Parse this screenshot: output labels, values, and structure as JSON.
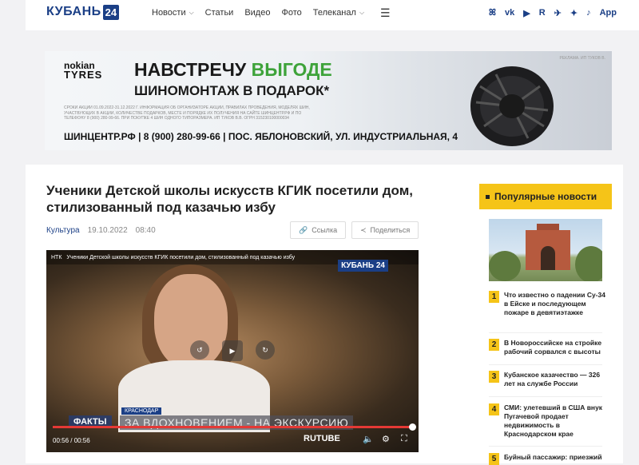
{
  "header": {
    "logo_text": "КУБАНЬ",
    "logo_num": "24",
    "nav": [
      {
        "label": "Новости",
        "has_dropdown": true
      },
      {
        "label": "Статьи",
        "has_dropdown": false
      },
      {
        "label": "Видео",
        "has_dropdown": false
      },
      {
        "label": "Фото",
        "has_dropdown": false
      },
      {
        "label": "Телеканал",
        "has_dropdown": true
      }
    ],
    "socials": [
      "ok",
      "vk",
      "yt",
      "R",
      "tg",
      "zen",
      "tt",
      "App"
    ]
  },
  "banner": {
    "brand_line1": "nokian",
    "brand_line2": "TYRES",
    "headline_part1": "НАВСТРЕЧУ ",
    "headline_part2": "ВЫГОДЕ",
    "headline2": "ШИНОМОНТАЖ В ПОДАРОК*",
    "ad_note": "РЕКЛАМА. ИП ТУКОВ В.",
    "fine_print": "СРОКИ АКЦИИ 01.09.2022-31.12.2022 Г. ИНФОРМАЦИЯ ОБ ОРГАНИЗАТОРЕ АКЦИИ, ПРАВИЛАХ ПРОВЕДЕНИЯ, МОДЕЛЯХ ШИН, УЧАСТВУЮЩИХ В АКЦИИ, КОЛИЧЕСТВЕ ПОДАРКОВ, МЕСТЕ И ПОРЯДКЕ ИХ ПОЛУЧЕНИЯ НА САЙТЕ ШИНЦЕНТР.РФ И ПО ТЕЛЕФОНУ 8 (900) 280-99-66. ПРИ ПОКУПКЕ 4 ШИН ОДНОГО ТИПОРАЗМЕРА. ИП ТУКОВ В.В. ОГРН 315230100000034",
    "contact": "ШИНЦЕНТР.РФ | 8 (900) 280-99-66 | ПОС. ЯБЛОНОВСКИЙ, УЛ. ИНДУСТРИАЛЬНАЯ, 4"
  },
  "article": {
    "title": "Ученики Детской школы искусств КГИК посетили дом, стилизованный под казачью избу",
    "category": "Культура",
    "date": "19.10.2022",
    "time": "08:40",
    "link_button": "Ссылка",
    "share_button": "Поделиться"
  },
  "video": {
    "channel": "НТК",
    "title": "Ученики Детской школы искусств КГИК посетили дом, стилизованный под казачью избу",
    "logo": "КУБАНЬ 24",
    "city": "КРАСНОДАР",
    "rubric": "ФАКТЫ",
    "caption": "ЗА ВДОХНОВЕНИЕМ - НА ЭКСКУРСИЮ",
    "time": "00:56 / 00:56",
    "player": "RUTUBE",
    "progress": 1.0
  },
  "sidebar": {
    "title": "Популярные новости",
    "items": [
      {
        "num": "1",
        "text": "Что известно о падении Су-34 в Ейске и последующем пожаре в девятиэтажке"
      },
      {
        "num": "2",
        "text": "В Новороссийске на стройке рабочий сорвался с высоты"
      },
      {
        "num": "3",
        "text": "Кубанское казачество — 326 лет на службе России"
      },
      {
        "num": "4",
        "text": "СМИ: улетевший в США внук Пугачевой продает недвижимость в Краснодарском крае"
      },
      {
        "num": "5",
        "text": "Буйный пассажир: приезжий"
      }
    ]
  }
}
